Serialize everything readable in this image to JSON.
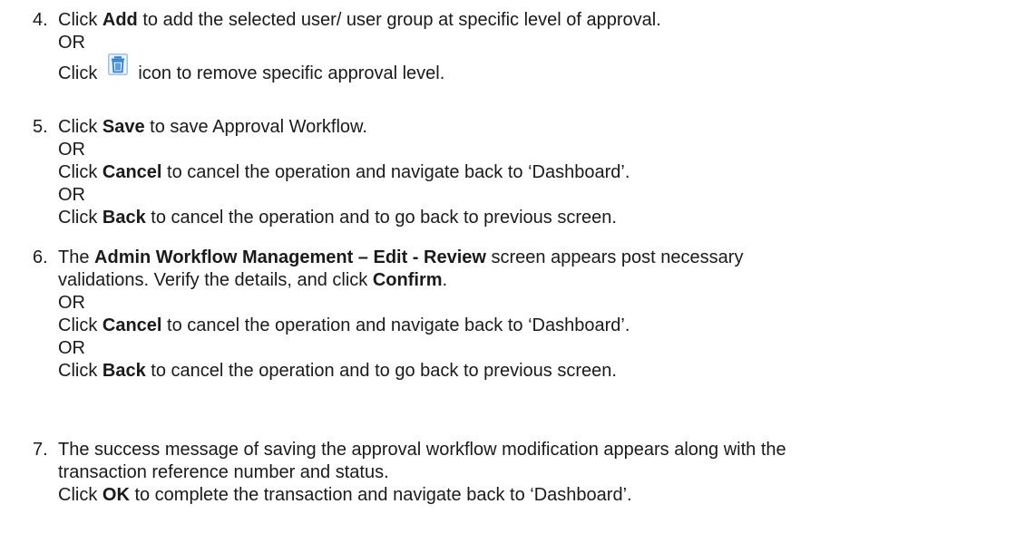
{
  "steps": [
    {
      "number": "4.",
      "lines": [
        {
          "pre": "Click ",
          "bold": "Add",
          "post": " to add the selected user/ user group at specific level of approval."
        },
        {
          "pre": "OR",
          "bold": "",
          "post": ""
        },
        {
          "pre": "Click",
          "icon": "delete-icon",
          "post": "icon to remove specific approval level."
        }
      ]
    },
    {
      "number": "5.",
      "lines": [
        {
          "pre": "Click ",
          "bold": "Save",
          "post": " to save Approval Workflow."
        },
        {
          "pre": "OR",
          "bold": "",
          "post": ""
        },
        {
          "pre": "Click ",
          "bold": "Cancel",
          "post": " to cancel the operation and navigate back to ‘Dashboard’."
        },
        {
          "pre": "OR",
          "bold": "",
          "post": ""
        },
        {
          "pre": "Click ",
          "bold": "Back",
          "post": " to cancel the operation and to go back to previous screen."
        }
      ]
    },
    {
      "number": "6.",
      "lines": [
        {
          "pre": "The ",
          "bold": "Admin Workflow Management – Edit - Review",
          "post": " screen appears post necessary"
        },
        {
          "pre": "validations. Verify the details, and click ",
          "bold": "Confirm",
          "post": "."
        },
        {
          "pre": "OR",
          "bold": "",
          "post": ""
        },
        {
          "pre": "Click ",
          "bold": "Cancel",
          "post": " to cancel the operation and navigate back to ‘Dashboard’."
        },
        {
          "pre": "OR",
          "bold": "",
          "post": ""
        },
        {
          "pre": "Click ",
          "bold": "Back",
          "post": " to cancel the operation and to go back to previous screen."
        }
      ]
    },
    {
      "number": "7.",
      "lines": [
        {
          "pre": "The success message of saving the approval workflow modification appears along with the",
          "bold": "",
          "post": ""
        },
        {
          "pre": "transaction reference number and status.",
          "bold": "",
          "post": ""
        },
        {
          "pre": "Click ",
          "bold": "OK",
          "post": " to complete the transaction and navigate back to ‘Dashboard’."
        }
      ]
    }
  ],
  "icon_color": "#2f7fd0"
}
